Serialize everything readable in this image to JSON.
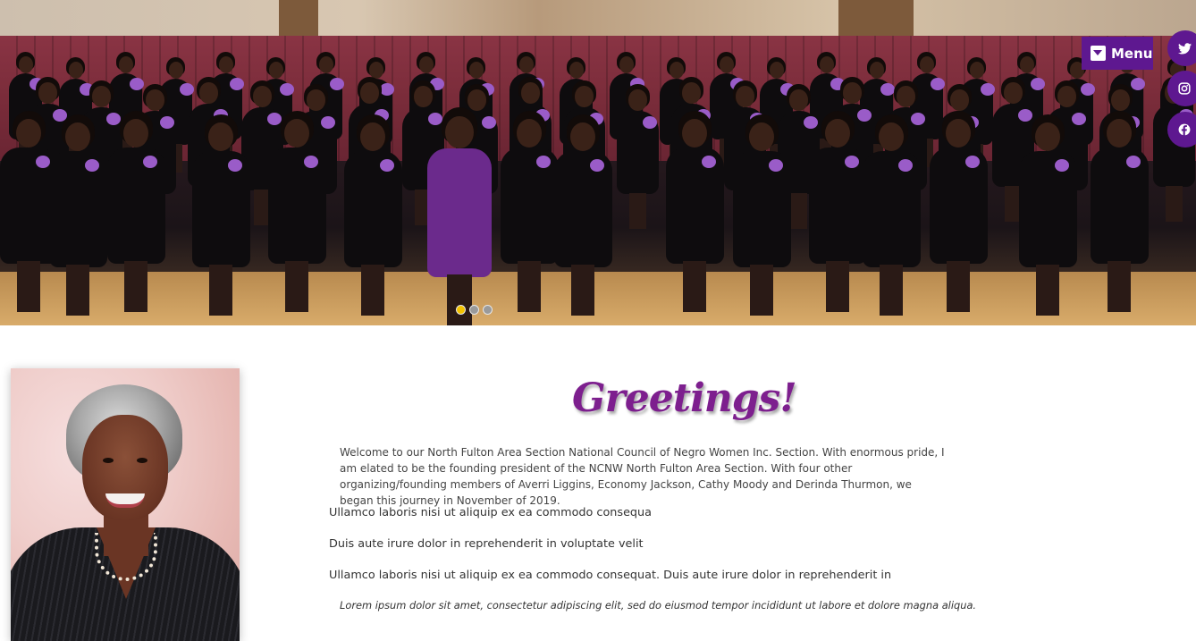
{
  "hero": {
    "slides": 3,
    "active_slide": 1
  },
  "nav": {
    "menu_label": "Menu",
    "menu_icon": "caret-down-square-icon"
  },
  "social": {
    "items": [
      {
        "name": "twitter",
        "icon": "twitter-icon"
      },
      {
        "name": "instagram",
        "icon": "instagram-icon"
      },
      {
        "name": "facebook",
        "icon": "facebook-icon"
      }
    ]
  },
  "content": {
    "title": "Greetings!",
    "intro": "Welcome to our North Fulton Area Section National Council of Negro Women Inc. Section. With enormous pride, I am elated to be the founding president of the NCNW North Fulton Area Section. With four other organizing/founding members of Averri Liggins, Economy Jackson, Cathy Moody and Derinda Thurmon, we began this journey in November of 2019.",
    "line1": "Ullamco laboris nisi ut aliquip ex ea commodo consequa",
    "line2": "Duis aute irure dolor in reprehenderit in voluptate velit",
    "line3": "Ullamco laboris nisi ut aliquip ex ea commodo consequat. Duis aute irure dolor in reprehenderit in",
    "quote": "Lorem ipsum dolor sit amet, consectetur adipiscing elit, sed do eiusmod tempor incididunt ut labore et dolore magna aliqua."
  },
  "colors": {
    "brand_purple": "#5e1890",
    "title_purple": "#7d1f8e",
    "slider_active": "#f2c200"
  }
}
